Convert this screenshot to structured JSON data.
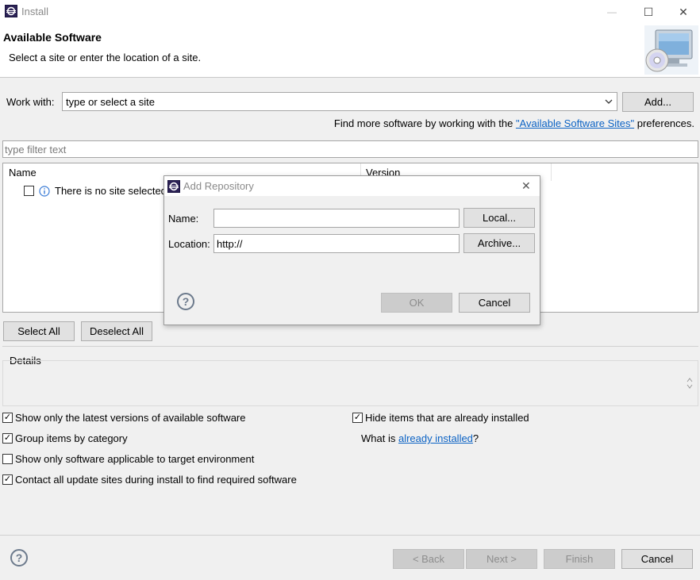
{
  "window": {
    "title": "Install",
    "minimize": "—",
    "maximize": "☐",
    "close": "✕"
  },
  "banner": {
    "title": "Available Software",
    "subtitle": "Select a site or enter the location of a site."
  },
  "work_with": {
    "label": "Work with:",
    "value": "type or select a site",
    "add_label": "Add...",
    "find_more_prefix": "Find more software by working with the ",
    "find_more_link": "\"Available Software Sites\"",
    "find_more_suffix": " preferences."
  },
  "filter": {
    "placeholder": "type filter text"
  },
  "tree": {
    "columns": [
      "Name",
      "Version"
    ],
    "rows": [
      {
        "checked": false,
        "icon": "info-icon",
        "text": "There is no site selected."
      }
    ]
  },
  "selection_buttons": {
    "select_all": "Select All",
    "deselect_all": "Deselect All"
  },
  "details": {
    "label": "Details"
  },
  "options": {
    "latest_versions": {
      "label": "Show only the latest versions of available software",
      "checked": true
    },
    "group_by_category": {
      "label": "Group items by category",
      "checked": true
    },
    "target_env": {
      "label": "Show only software applicable to target environment",
      "checked": false
    },
    "contact_sites": {
      "label": "Contact all update sites during install to find required software",
      "checked": true
    },
    "hide_installed": {
      "label": "Hide items that are already installed",
      "checked": true
    },
    "what_is_prefix": "What is ",
    "what_is_link": "already installed",
    "what_is_suffix": "?"
  },
  "footer": {
    "back": "< Back",
    "next": "Next >",
    "finish": "Finish",
    "cancel": "Cancel"
  },
  "dialog": {
    "title": "Add Repository",
    "close": "✕",
    "name_label": "Name:",
    "name_value": "",
    "location_label": "Location:",
    "location_value": "http://",
    "local_label": "Local...",
    "archive_label": "Archive...",
    "ok_label": "OK",
    "cancel_label": "Cancel"
  },
  "help": "?"
}
